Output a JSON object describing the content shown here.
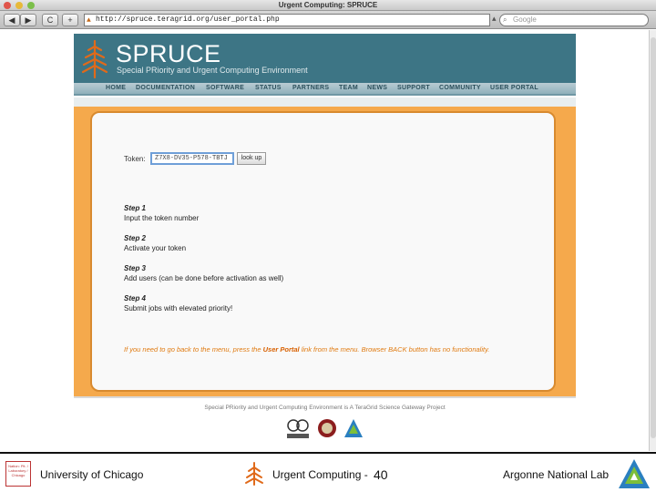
{
  "browser": {
    "window_title": "Urgent Computing: SPRUCE",
    "url": "http://spruce.teragrid.org/user_portal.php",
    "search_placeholder": "Google",
    "back_label": "◀",
    "forward_label": "▶",
    "reload_label": "C",
    "add_label": "+"
  },
  "site": {
    "title": "SPRUCE",
    "subtitle": "Special PRiority and Urgent Computing Environment",
    "nav": [
      "HOME",
      "DOCUMENTATION",
      "SOFTWARE",
      "STATUS",
      "PARTNERS",
      "TEAM",
      "NEWS",
      "SUPPORT",
      "COMMUNITY",
      "USER PORTAL"
    ]
  },
  "portal": {
    "token_label": "Token:",
    "token_value": "Z7X8-DV35-P578-TBTJ",
    "lookup_label": "look up",
    "steps": [
      {
        "title": "Step 1",
        "desc": "Input the token number"
      },
      {
        "title": "Step 2",
        "desc": "Activate your token"
      },
      {
        "title": "Step 3",
        "desc": "Add users (can be done before activation as well)"
      },
      {
        "title": "Step 4",
        "desc": "Submit jobs with elevated priority!"
      }
    ],
    "note_before": "If you need to go back to the menu, press the ",
    "note_link": "User Portal",
    "note_after": " link from the menu. Browser BACK button has no functionality."
  },
  "footer": {
    "text": "Special PRiority and Urgent Computing Environment is A TeraGrid Science Gateway Project"
  },
  "slide": {
    "left": "University of Chicago",
    "middle": "Urgent Computing -",
    "number": "40",
    "right": "Argonne National Lab",
    "uc_logo_text": "Nation: Pit. / Laboratory / Chicago"
  },
  "colors": {
    "header": "#3d7585",
    "content_orange": "#f5a94c",
    "note_orange": "#e07a10",
    "tree_orange": "#e06a1a"
  }
}
